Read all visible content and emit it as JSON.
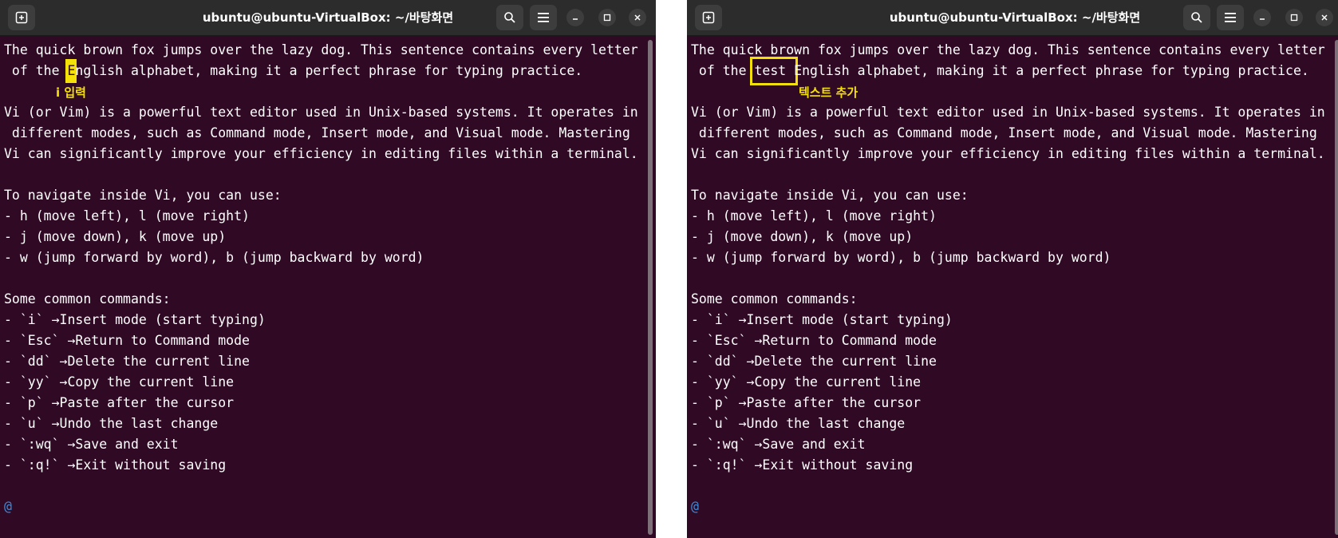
{
  "windows": [
    {
      "title": "ubuntu@ubuntu-VirtualBox: ~/바탕화면",
      "annotation": "i 입력",
      "lines": [
        "The quick brown fox jumps over the lazy dog. This sentence contains every letter",
        " of the ",
        "",
        "Vi (or Vim) is a powerful text editor used in Unix-based systems. It operates in",
        " different modes, such as Command mode, Insert mode, and Visual mode. Mastering",
        "Vi can significantly improve your efficiency in editing files within a terminal.",
        "",
        "To navigate inside Vi, you can use:",
        "- h (move left), l (move right)",
        "- j (move down), k (move up)",
        "- w (jump forward by word), b (jump backward by word)",
        "",
        "Some common commands:",
        "- `i` →Insert mode (start typing)",
        "- `Esc` →Return to Command mode",
        "- `dd` →Delete the current line",
        "- `yy` →Copy the current line",
        "- `p` →Paste after the cursor",
        "- `u` →Undo the last change",
        "- `:wq` →Save and exit",
        "- `:q!` →Exit without saving",
        "",
        "@"
      ],
      "line2_highlight": "E",
      "line2_rest": "nglish alphabet, making it a perfect phrase for typing practice."
    },
    {
      "title": "ubuntu@ubuntu-VirtualBox: ~/바탕화면",
      "annotation": "텍스트 추가",
      "lines": [
        "The quick brown fox jumps over the lazy dog. This sentence contains every letter",
        " of the ",
        "",
        "Vi (or Vim) is a powerful text editor used in Unix-based systems. It operates in",
        " different modes, such as Command mode, Insert mode, and Visual mode. Mastering",
        "Vi can significantly improve your efficiency in editing files within a terminal.",
        "",
        "To navigate inside Vi, you can use:",
        "- h (move left), l (move right)",
        "- j (move down), k (move up)",
        "- w (jump forward by word), b (jump backward by word)",
        "",
        "Some common commands:",
        "- `i` →Insert mode (start typing)",
        "- `Esc` →Return to Command mode",
        "- `dd` →Delete the current line",
        "- `yy` →Copy the current line",
        "- `p` →Paste after the cursor",
        "- `u` →Undo the last change",
        "- `:wq` →Save and exit",
        "- `:q!` →Exit without saving",
        "",
        "@"
      ],
      "line2_highlight": "test ",
      "line2_rest": "English alphabet, making it a perfect phrase for typing practice."
    }
  ],
  "icons": {
    "new_tab": "new-tab-icon",
    "search": "search-icon",
    "menu": "hamburger-menu-icon",
    "minimize": "minimize-icon",
    "maximize": "maximize-icon",
    "close": "close-icon"
  },
  "colors": {
    "terminal_bg": "#300a24",
    "titlebar_bg": "#2c2c2c",
    "annotation": "#f5e10a",
    "prompt": "#3d8bd9"
  }
}
